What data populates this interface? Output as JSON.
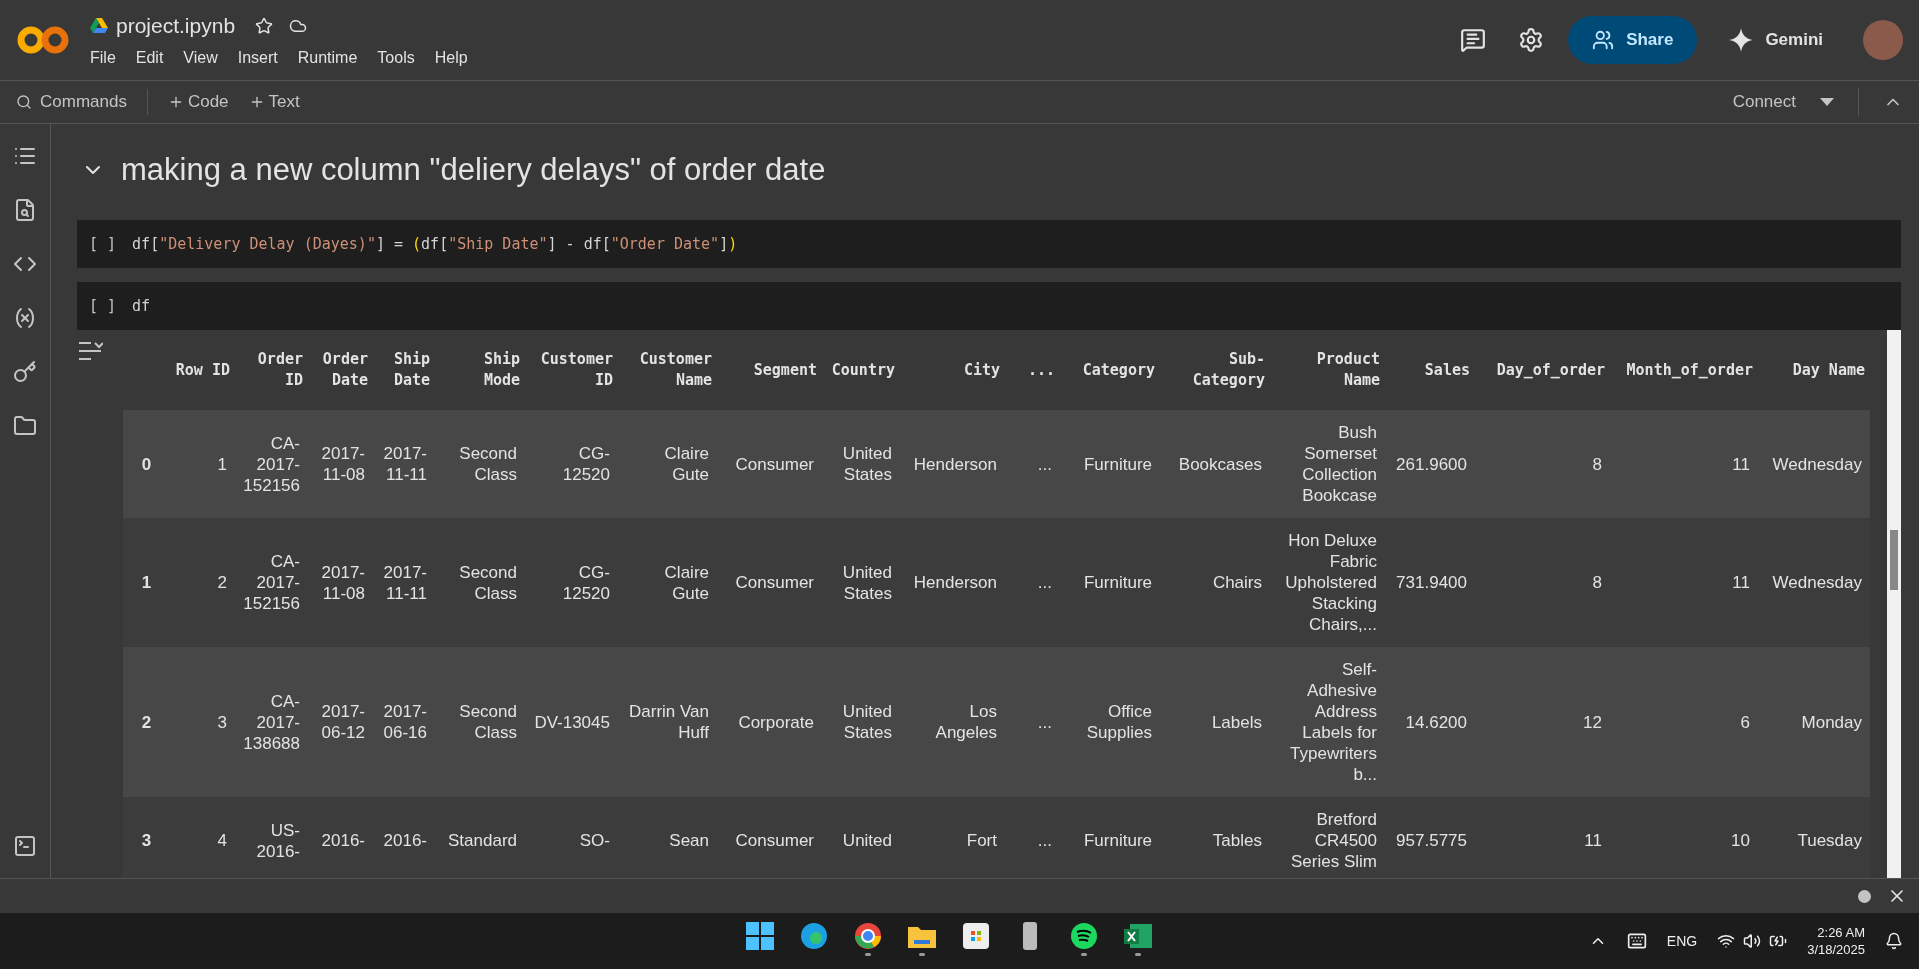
{
  "app": {
    "title": "project.ipynb",
    "menu": [
      "File",
      "Edit",
      "View",
      "Insert",
      "Runtime",
      "Tools",
      "Help"
    ]
  },
  "header_actions": {
    "share": "Share",
    "gemini": "Gemini"
  },
  "toolbar": {
    "commands": "Commands",
    "add_code": "Code",
    "add_text": "Text",
    "connect": "Connect"
  },
  "section": {
    "title": "making a new column \"deliery delays\" of order date",
    "expanded": true
  },
  "cells": [
    {
      "prompt": "[ ]",
      "tokens": [
        {
          "kind": "plain",
          "text": "df["
        },
        {
          "kind": "string",
          "text": "\"Delivery Delay (Dayes)\""
        },
        {
          "kind": "plain",
          "text": "] = "
        },
        {
          "kind": "paren",
          "text": "("
        },
        {
          "kind": "plain",
          "text": "df["
        },
        {
          "kind": "string",
          "text": "\"Ship Date\""
        },
        {
          "kind": "plain",
          "text": "] - df["
        },
        {
          "kind": "string",
          "text": "\"Order Date\""
        },
        {
          "kind": "plain",
          "text": "]"
        },
        {
          "kind": "paren",
          "text": ")"
        }
      ]
    },
    {
      "prompt": "[ ]",
      "tokens": [
        {
          "kind": "plain",
          "text": "df"
        }
      ]
    }
  ],
  "table": {
    "columns": [
      "Row ID",
      "Order ID",
      "Order Date",
      "Ship Date",
      "Ship Mode",
      "Customer ID",
      "Customer Name",
      "Segment",
      "Country",
      "City",
      "...",
      "Category",
      "Sub-Category",
      "Product Name",
      "Sales",
      "Day_of_order",
      "Month_of_order",
      "Day Name"
    ],
    "rows": [
      {
        "index": "0",
        "cells": [
          "1",
          "CA-2017-152156",
          "2017-11-08",
          "2017-11-11",
          "Second Class",
          "CG-12520",
          "Claire Gute",
          "Consumer",
          "United States",
          "Henderson",
          "...",
          "Furniture",
          "Bookcases",
          "Bush Somerset Collection Bookcase",
          "261.9600",
          "8",
          "11",
          "Wednesday"
        ]
      },
      {
        "index": "1",
        "cells": [
          "2",
          "CA-2017-152156",
          "2017-11-08",
          "2017-11-11",
          "Second Class",
          "CG-12520",
          "Claire Gute",
          "Consumer",
          "United States",
          "Henderson",
          "...",
          "Furniture",
          "Chairs",
          "Hon Deluxe Fabric Upholstered Stacking Chairs,...",
          "731.9400",
          "8",
          "11",
          "Wednesday"
        ]
      },
      {
        "index": "2",
        "cells": [
          "3",
          "CA-2017-138688",
          "2017-06-12",
          "2017-06-16",
          "Second Class",
          "DV-13045",
          "Darrin Van Huff",
          "Corporate",
          "United States",
          "Los Angeles",
          "...",
          "Office Supplies",
          "Labels",
          "Self-Adhesive Address Labels for Typewriters b...",
          "14.6200",
          "12",
          "6",
          "Monday"
        ]
      },
      {
        "index": "3",
        "cells": [
          "4",
          "US-2016-",
          "2016-",
          "2016-",
          "Standard",
          "SO-",
          "Sean",
          "Consumer",
          "United",
          "Fort",
          "...",
          "Furniture",
          "Tables",
          "Bretford CR4500 Series Slim",
          "957.5775",
          "11",
          "10",
          "Tuesday"
        ]
      }
    ]
  },
  "taskbar": {
    "language": "ENG",
    "time": "2:26 AM",
    "date": "3/18/2025"
  }
}
